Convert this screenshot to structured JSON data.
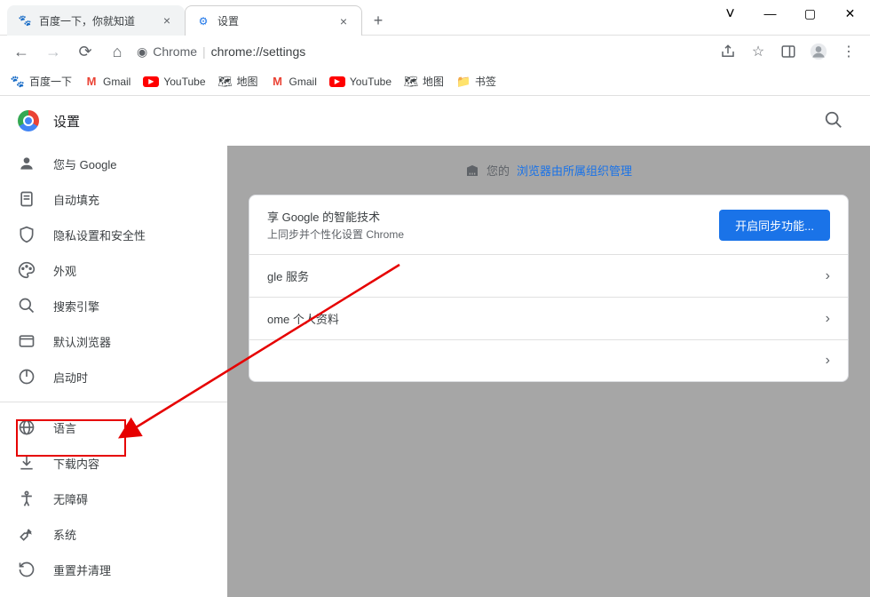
{
  "tabs": [
    {
      "title": "百度一下，你就知道",
      "active": false,
      "favicon": "baidu"
    },
    {
      "title": "设置",
      "active": true,
      "favicon": "gear"
    }
  ],
  "addressbar": {
    "chrome_label": "Chrome",
    "url_path": "chrome://settings"
  },
  "bookmarks": [
    {
      "label": "百度一下",
      "icon": "baidu"
    },
    {
      "label": "Gmail",
      "icon": "gmail"
    },
    {
      "label": "YouTube",
      "icon": "youtube"
    },
    {
      "label": "地图",
      "icon": "maps"
    },
    {
      "label": "Gmail",
      "icon": "gmail"
    },
    {
      "label": "YouTube",
      "icon": "youtube"
    },
    {
      "label": "地图",
      "icon": "maps"
    },
    {
      "label": "书签",
      "icon": "folder"
    }
  ],
  "settings": {
    "title": "设置",
    "managed_prefix": "您的",
    "managed_link": "浏览器由所属组织管理",
    "sidebar": [
      {
        "label": "您与 Google",
        "icon": "person"
      },
      {
        "label": "自动填充",
        "icon": "autofill"
      },
      {
        "label": "隐私设置和安全性",
        "icon": "shield"
      },
      {
        "label": "外观",
        "icon": "palette"
      },
      {
        "label": "搜索引擎",
        "icon": "search"
      },
      {
        "label": "默认浏览器",
        "icon": "browser"
      },
      {
        "label": "启动时",
        "icon": "power"
      }
    ],
    "sidebar2": [
      {
        "label": "语言",
        "icon": "globe"
      },
      {
        "label": "下载内容",
        "icon": "download"
      },
      {
        "label": "无障碍",
        "icon": "accessibility"
      },
      {
        "label": "系统",
        "icon": "wrench"
      },
      {
        "label": "重置并清理",
        "icon": "restore"
      }
    ],
    "sync_card": {
      "line1": "享 Google 的智能技术",
      "line2": "上同步并个性化设置 Chrome",
      "button": "开启同步功能..."
    },
    "rows": [
      {
        "label": "gle 服务"
      },
      {
        "label": "ome 个人资料"
      },
      {
        "label": ""
      }
    ]
  }
}
